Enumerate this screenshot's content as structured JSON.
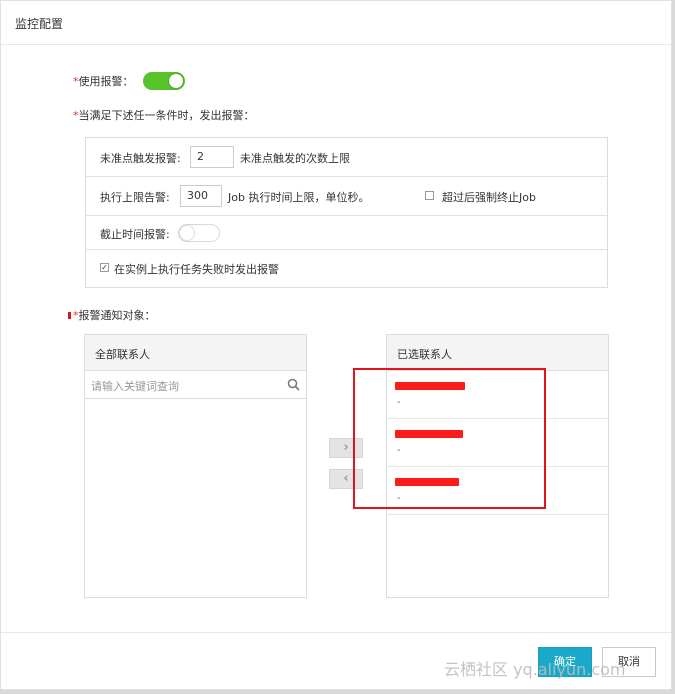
{
  "dialog": {
    "title": "监控配置"
  },
  "alert": {
    "required_mark": "*",
    "enable_label": "使用报警：",
    "enabled": true
  },
  "trigger": {
    "required_mark": "*",
    "intro": "当满足下述任一条件时，发出报警："
  },
  "conditions": {
    "not_triggered": {
      "label": "未准点触发报警:",
      "value": "2",
      "suffix": "未准点触发的次数上限"
    },
    "exec_limit": {
      "label": "执行上限告警:",
      "value": "300",
      "suffix": "Job 执行时间上限，单位秒。",
      "force_stop_label": "超过后强制终止Job",
      "force_stop_checked": false
    },
    "deadline": {
      "label": "截止时间报警:",
      "enabled": false
    },
    "instance_fail": {
      "label": "在实例上执行任务失败时发出报警",
      "checked": true
    }
  },
  "recipients": {
    "required_mark": "*",
    "label": "报警通知对象：",
    "all_contacts": {
      "header": "全部联系人",
      "search_placeholder": "请输入关键词查询",
      "search_value": ""
    },
    "move_right": "›",
    "move_left": "‹",
    "selected": {
      "header": "已选联系人",
      "items": [
        {
          "detail": "-"
        },
        {
          "detail": "-"
        },
        {
          "detail": "-"
        }
      ]
    }
  },
  "footer": {
    "confirm_label": "确定",
    "cancel_label": "取消"
  },
  "watermark": "云栖社区 yq.aliyun.com",
  "colors": {
    "toggle_on": "#55c32a",
    "primary": "#1aa9c8",
    "required": "#e03030",
    "highlight": "#e0141e"
  }
}
